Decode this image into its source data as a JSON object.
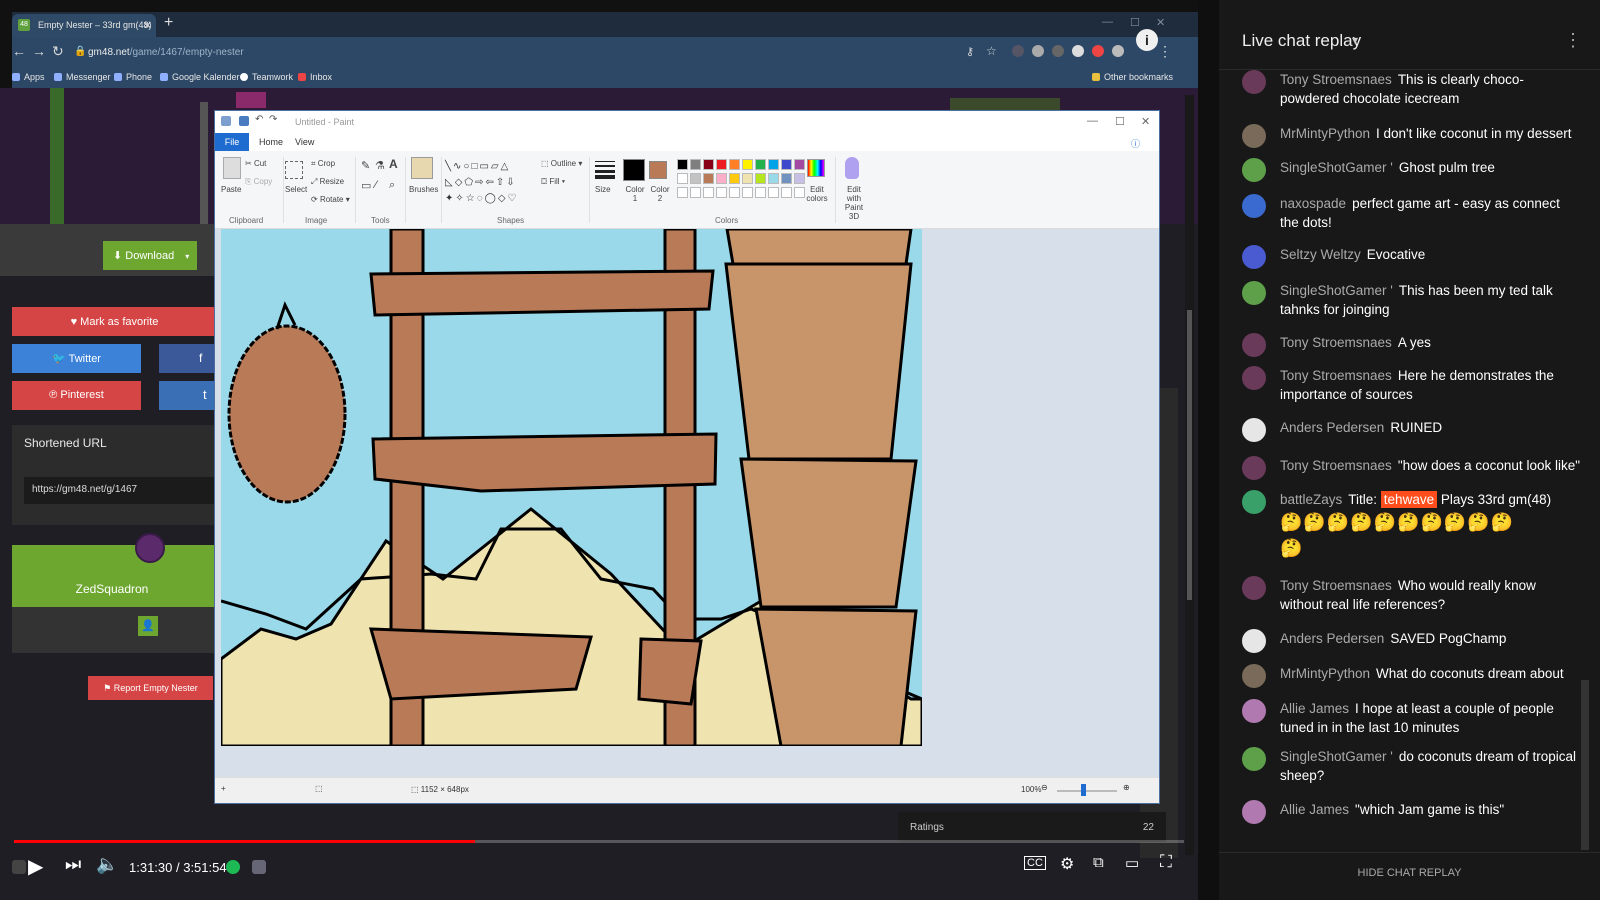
{
  "browser": {
    "tab_title": "Empty Nester – 33rd gm(48)",
    "tab_icon": "48",
    "url_host": "gm48.net",
    "url_path": "/game/1467/empty-nester",
    "bookmarks": [
      "Apps",
      "Messenger",
      "Phone",
      "Google Kalender",
      "Teamwork",
      "Inbox"
    ],
    "other_bookmarks": "Other bookmarks"
  },
  "gamepage": {
    "download_label": "Download",
    "favorite_label": "Mark as favorite",
    "twitter_label": "Twitter",
    "facebook_label": "f",
    "pinterest_label": "Pinterest",
    "tumblr_label": "t",
    "shortened_url_title": "Shortened URL",
    "shortened_url": "https://gm48.net/g/1467",
    "author_name": "ZedSquadron",
    "report_label": "Report Empty Nester",
    "ratings_label": "Ratings",
    "ratings_count": "22"
  },
  "paint": {
    "title": "Untitled - Paint",
    "tabs": [
      "File",
      "Home",
      "View"
    ],
    "ribbon": {
      "clipboard": "Clipboard",
      "paste": "Paste",
      "cut": "Cut",
      "copy": "Copy",
      "image": "Image",
      "select": "Select",
      "crop": "Crop",
      "resize": "Resize",
      "rotate": "Rotate",
      "tools": "Tools",
      "brushes": "Brushes",
      "shapes": "Shapes",
      "outline": "Outline",
      "fill": "Fill",
      "size": "Size",
      "color1": "Color 1",
      "color2": "Color 2",
      "colors": "Colors",
      "edit_colors": "Edit colors",
      "edit_with_3d": "Edit with Paint 3D"
    },
    "palette": [
      "#000000",
      "#7f7f7f",
      "#880015",
      "#ed1c24",
      "#ff7f27",
      "#fff200",
      "#22b14c",
      "#00a2e8",
      "#3f48cc",
      "#a349a4",
      "#ffffff",
      "#c3c3c3",
      "#b97a57",
      "#ffaec9",
      "#ffc90e",
      "#efe4b0",
      "#b5e61d",
      "#99d9ea",
      "#7092be",
      "#c8bfe7"
    ],
    "canvas_size": "1152 × 648px",
    "zoom": "100%"
  },
  "player": {
    "time_current": "1:31:30",
    "time_total": "3:51:54",
    "time_display": "1:31:30 / 3:51:54",
    "progress": 0.394
  },
  "chat": {
    "title": "Live chat replay",
    "footer": "HIDE CHAT REPLAY",
    "messages": [
      {
        "author": "Tony Stroemsnaes",
        "text": "This is clearly choco-powdered chocolate icecream",
        "color": "#6a3a5a"
      },
      {
        "author": "MrMintyPython",
        "text": "I don't like coconut in my dessert",
        "color": "#7a6a5a"
      },
      {
        "author": "SingleShotGamer '",
        "text": "Ghost pulm tree",
        "color": "#5ea04a"
      },
      {
        "author": "naxospade",
        "text": "perfect game art - easy as connect the dots!",
        "color": "#3a6ad0"
      },
      {
        "author": "Seltzy Weltzy",
        "text": "Evocative",
        "color": "#4a5ad0"
      },
      {
        "author": "SingleShotGamer '",
        "text": "This has been my ted talk tahnks for joinging",
        "color": "#5ea04a"
      },
      {
        "author": "Tony Stroemsnaes",
        "text": "A yes",
        "color": "#6a3a5a"
      },
      {
        "author": "Tony Stroemsnaes",
        "text": "Here he demonstrates the importance of sources",
        "color": "#6a3a5a"
      },
      {
        "author": "Anders Pedersen",
        "text": "RUINED",
        "color": "#e6e6e6"
      },
      {
        "author": "Tony Stroemsnaes",
        "text": "\"how does a coconut look like\"",
        "color": "#6a3a5a"
      },
      {
        "author": "battleZays",
        "text_before": "Title:",
        "highlight": "tehwave",
        "text_after": "Plays 33rd gm(48)",
        "emojis": "🤔🤔🤔🤔🤔🤔🤔🤔🤔🤔",
        "emojis_2": "🤔",
        "color": "#3aa06a"
      },
      {
        "author": "Tony Stroemsnaes",
        "text": "Who would really know without real life references?",
        "color": "#6a3a5a"
      },
      {
        "author": "Anders Pedersen",
        "text": "SAVED PogChamp",
        "color": "#e6e6e6"
      },
      {
        "author": "MrMintyPython",
        "text": "What do coconuts dream about",
        "color": "#7a6a5a"
      },
      {
        "author": "Allie James",
        "text": "I hope at least a couple of people tuned in in the last 10 minutes",
        "color": "#b07ab0"
      },
      {
        "author": "SingleShotGamer '",
        "text": "do coconuts dream of tropical sheep?",
        "color": "#5ea04a"
      },
      {
        "author": "Allie James",
        "text": "\"which Jam game is this\"",
        "color": "#b07ab0"
      }
    ]
  }
}
